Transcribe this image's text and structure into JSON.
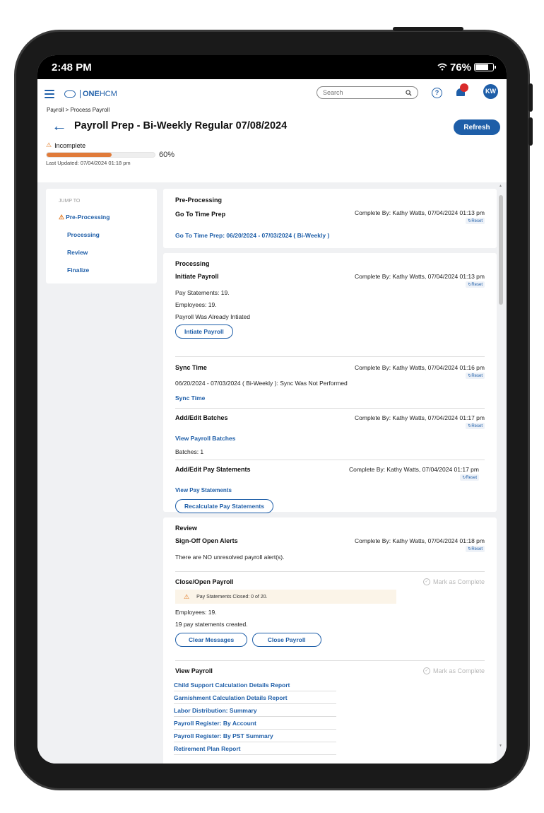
{
  "status_bar": {
    "time": "2:48 PM",
    "battery": "76%",
    "battery_level": 0.76
  },
  "app": {
    "logo_one": "ONE",
    "logo_hcm": "HCM",
    "search_placeholder": "Search",
    "help_glyph": "?",
    "avatar_initials": "KW"
  },
  "breadcrumb": "Payroll > Process Payroll",
  "page_title": "Payroll Prep - Bi-Weekly Regular 07/08/2024",
  "refresh_label": "Refresh",
  "status": {
    "label": "Incomplete",
    "progress": 0.6,
    "progress_text": "60%",
    "last_updated": "Last Updated: 07/04/2024 01:18 pm"
  },
  "jump": {
    "heading": "JUMP TO",
    "items": [
      "Pre-Processing",
      "Processing",
      "Review",
      "Finalize"
    ]
  },
  "reset_label": "Reset",
  "mark_complete_label": "Mark as Complete",
  "preprocessing": {
    "heading": "Pre-Processing",
    "step_title": "Go To Time Prep",
    "complete_by": "Complete By: Kathy Watts, 07/04/2024 01:13 pm",
    "link": "Go To Time Prep: 06/20/2024 - 07/03/2024 ( Bi-Weekly )"
  },
  "processing": {
    "heading": "Processing",
    "initiate": {
      "title": "Initiate Payroll",
      "complete_by": "Complete By: Kathy Watts, 07/04/2024 01:13 pm",
      "lines": [
        "Pay Statements: 19.",
        "Employees: 19.",
        "Payroll Was Already Intiated"
      ],
      "button": "Intiate Payroll"
    },
    "sync": {
      "title": "Sync Time",
      "complete_by": "Complete By: Kathy Watts, 07/04/2024 01:16 pm",
      "line": "06/20/2024 - 07/03/2024 ( Bi-Weekly ): Sync Was Not Performed",
      "link": "Sync Time"
    },
    "batches": {
      "title": "Add/Edit Batches",
      "complete_by": "Complete By: Kathy Watts, 07/04/2024 01:17 pm",
      "link": "View Payroll Batches",
      "line": "Batches: 1"
    },
    "paystatements": {
      "title": "Add/Edit Pay Statements",
      "complete_by": "Complete By: Kathy Watts, 07/04/2024 01:17 pm",
      "link": "View Pay Statements",
      "button": "Recalculate Pay Statements"
    }
  },
  "review": {
    "heading": "Review",
    "signoff": {
      "title": "Sign-Off Open Alerts",
      "complete_by": "Complete By: Kathy Watts, 07/04/2024 01:18 pm",
      "line": "There are NO unresolved payroll alert(s)."
    },
    "close": {
      "title": "Close/Open Payroll",
      "alert": "Pay Statements Closed: 0 of 20.",
      "lines": [
        "Employees: 19.",
        "19 pay statements created."
      ],
      "button_clear": "Clear Messages",
      "button_close": "Close Payroll"
    },
    "view": {
      "title": "View Payroll",
      "reports": [
        "Child Support Calculation Details Report",
        "Garnishment Calculation Details Report",
        "Labor Distribution: Summary",
        "Payroll Register: By Account",
        "Payroll Register: By PST Summary",
        "Retirement Plan Report"
      ]
    }
  },
  "colors": {
    "brand": "#1e5ea8",
    "progress": "#e07b3a",
    "warning": "#e0761d",
    "alert_bg": "#fbf4e8"
  }
}
